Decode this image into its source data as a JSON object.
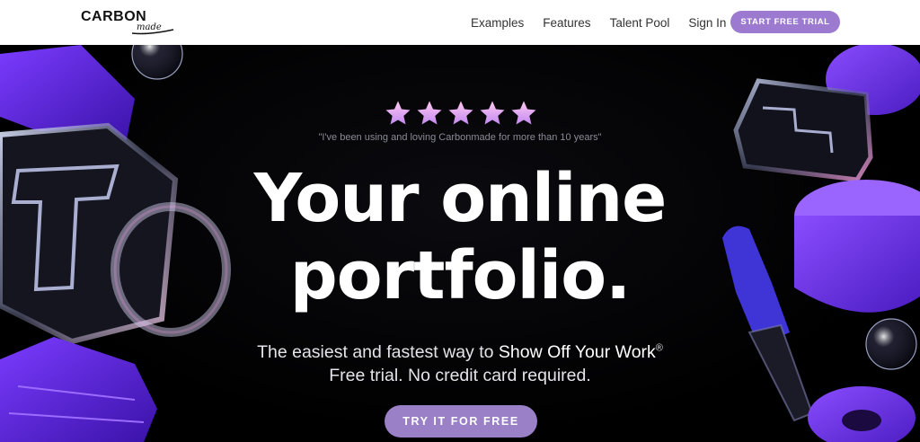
{
  "header": {
    "logo_main": "CARBON",
    "logo_sub": "made",
    "nav": [
      "Examples",
      "Features",
      "Talent Pool",
      "Sign In"
    ],
    "cta": "START FREE TRIAL"
  },
  "hero": {
    "rating_stars": 5,
    "quote": "\"I've been using and loving Carbonmade for more than 10 years\"",
    "headline_line1": "Your online",
    "headline_line2": "portfolio.",
    "sub_prefix": "The easiest and fastest way to ",
    "sub_strong": "Show Off Your Work",
    "sub_mark": "®",
    "sub_line2": "Free trial. No credit card required.",
    "cta": "TRY IT FOR FREE"
  },
  "colors": {
    "accent": "#9b7ad0",
    "purple": "#6b2fe0",
    "background": "#000000"
  }
}
